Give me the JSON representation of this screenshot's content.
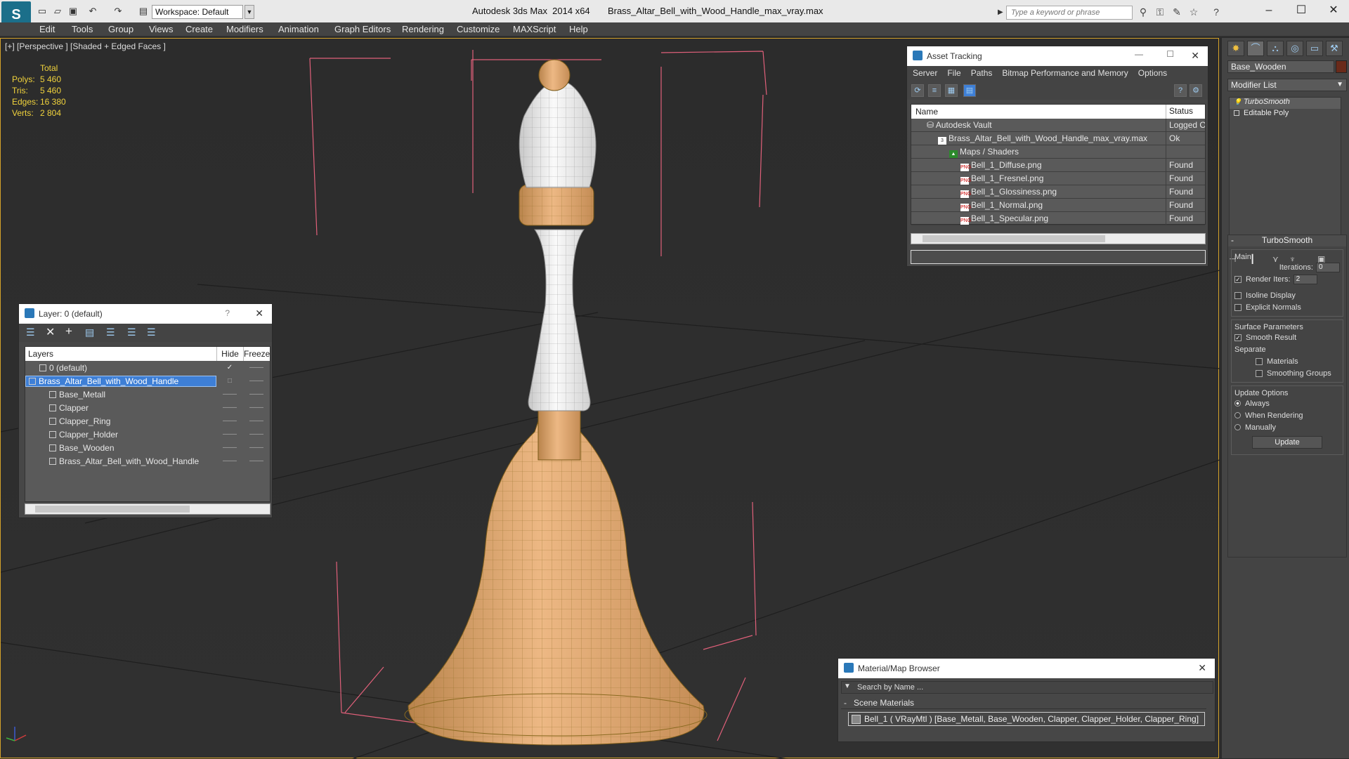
{
  "titlebar": {
    "workspace": "Workspace: Default",
    "title": "Autodesk 3ds Max  2014 x64       Brass_Altar_Bell_with_Wood_Handle_max_vray.max",
    "search_placeholder": "Type a keyword or phrase"
  },
  "menu": [
    "Edit",
    "Tools",
    "Group",
    "Views",
    "Create",
    "Modifiers",
    "Animation",
    "Graph Editors",
    "Rendering",
    "Customize",
    "MAXScript",
    "Help"
  ],
  "viewport": {
    "label": "[+] [Perspective ] [Shaded + Edged Faces ]",
    "stats": {
      "header": "Total",
      "rows": [
        {
          "k": "Polys:",
          "v": "5 460"
        },
        {
          "k": "Tris:",
          "v": "5 460"
        },
        {
          "k": "Edges:",
          "v": "16 380"
        },
        {
          "k": "Verts:",
          "v": "2 804"
        }
      ]
    }
  },
  "asset_tracking": {
    "title": "Asset Tracking",
    "menu": [
      "Server",
      "File",
      "Paths",
      "Bitmap Performance and Memory",
      "Options"
    ],
    "col_name": "Name",
    "col_status": "Status",
    "rows": [
      {
        "name": "Autodesk Vault",
        "status": "Logged O",
        "indent": 1
      },
      {
        "name": "Brass_Altar_Bell_with_Wood_Handle_max_vray.max",
        "status": "Ok",
        "indent": 2
      },
      {
        "name": "Maps / Shaders",
        "status": "",
        "indent": 3
      },
      {
        "name": "Bell_1_Diffuse.png",
        "status": "Found",
        "indent": 4
      },
      {
        "name": "Bell_1_Fresnel.png",
        "status": "Found",
        "indent": 4
      },
      {
        "name": "Bell_1_Glossiness.png",
        "status": "Found",
        "indent": 4
      },
      {
        "name": "Bell_1_Normal.png",
        "status": "Found",
        "indent": 4
      },
      {
        "name": "Bell_1_Specular.png",
        "status": "Found",
        "indent": 4
      }
    ]
  },
  "layers": {
    "title": "Layer: 0 (default)",
    "help": "?",
    "col_layers": "Layers",
    "col_hide": "Hide",
    "col_freeze": "Freeze",
    "rows": [
      {
        "name": "0 (default)",
        "indent": 1
      },
      {
        "name": "Brass_Altar_Bell_with_Wood_Handle",
        "indent": 0
      },
      {
        "name": "Base_Metall",
        "indent": 2
      },
      {
        "name": "Clapper",
        "indent": 2
      },
      {
        "name": "Clapper_Ring",
        "indent": 2
      },
      {
        "name": "Clapper_Holder",
        "indent": 2
      },
      {
        "name": "Base_Wooden",
        "indent": 2
      },
      {
        "name": "Brass_Altar_Bell_with_Wood_Handle",
        "indent": 2
      }
    ]
  },
  "material_browser": {
    "title": "Material/Map Browser",
    "search_placeholder": "Search by Name ...",
    "section": "Scene Materials",
    "item": "Bell_1  ( VRayMtl ) [Base_Metall, Base_Wooden, Clapper, Clapper_Holder, Clapper_Ring]"
  },
  "command_panel": {
    "object_name": "Base_Wooden",
    "modifier_list": "Modifier List",
    "stack": [
      "TurboSmooth",
      "Editable Poly"
    ],
    "rollout_title": "TurboSmooth",
    "main_label": "Main",
    "iterations_label": "Iterations:",
    "iterations_value": "0",
    "render_iters_label": "Render Iters:",
    "render_iters_value": "2",
    "isoline": "Isoline Display",
    "explicit_normals": "Explicit Normals",
    "surface_params": "Surface Parameters",
    "smooth_result": "Smooth Result",
    "separate": "Separate",
    "materials": "Materials",
    "smoothing_groups": "Smoothing Groups",
    "update_options": "Update Options",
    "always": "Always",
    "when_rendering": "When Rendering",
    "manually": "Manually",
    "update_btn": "Update"
  },
  "colors": {
    "accent": "#d4a22a",
    "selection": "#3e7fd6",
    "wood": "#e2a06a"
  }
}
